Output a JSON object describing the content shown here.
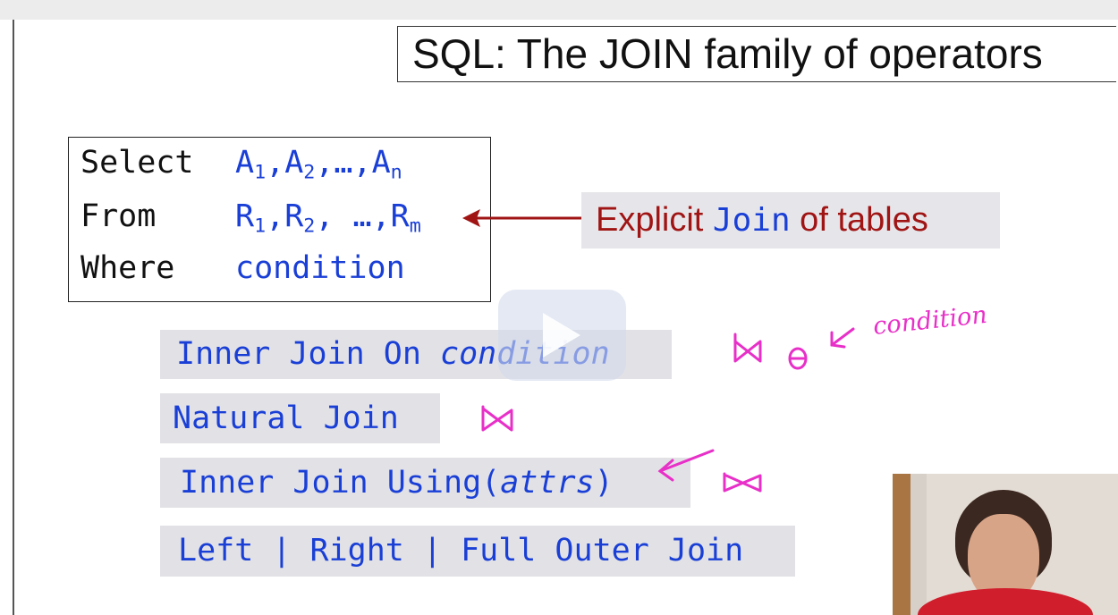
{
  "title": "SQL: The JOIN family of operators",
  "query": {
    "select_kw": "Select",
    "from_kw": "From",
    "where_kw": "Where",
    "select_val": "A1,A2,…,An",
    "from_val": "R1,R2, …,Rm",
    "where_val": "condition"
  },
  "callout": {
    "prefix": "Explicit ",
    "keyword": "Join",
    "suffix": "  of tables"
  },
  "joins": {
    "inner_on": {
      "kw": "Inner Join On ",
      "arg": "condition"
    },
    "natural": {
      "kw": "Natural Join"
    },
    "using": {
      "kw": "Inner Join Using(",
      "arg": "attrs",
      "close": ")"
    },
    "outer": {
      "kw": "Left | Right | Full  Outer Join"
    }
  },
  "annotation": "condition",
  "colors": {
    "keyword_blue": "#1a3fd6",
    "callout_red": "#a01414",
    "ink_pink": "#e830c8"
  }
}
